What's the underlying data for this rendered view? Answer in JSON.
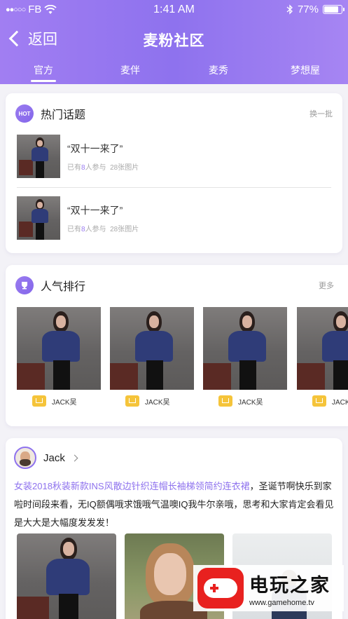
{
  "status": {
    "signal": "●●○○○",
    "carrier": "FB",
    "time": "1:41 AM",
    "battery": "77%",
    "battery_level": 0.77
  },
  "nav": {
    "back_label": "返回",
    "title": "麦粉社区"
  },
  "tabs": [
    {
      "label": "官方",
      "active": true
    },
    {
      "label": "麦伴",
      "active": false
    },
    {
      "label": "麦秀",
      "active": false
    },
    {
      "label": "梦想屋",
      "active": false
    }
  ],
  "hot_topics": {
    "title": "热门话题",
    "badge": "HOT",
    "action": "换一批",
    "items": [
      {
        "title": "“双十一来了”",
        "meta_prefix": "已有",
        "count": "8",
        "meta_mid": "人参与",
        "images": "28张图片"
      },
      {
        "title": "“双十一来了”",
        "meta_prefix": "已有",
        "count": "8",
        "meta_mid": "人参与",
        "images": "28张图片"
      }
    ]
  },
  "ranking": {
    "title": "人气排行",
    "action": "更多",
    "items": [
      {
        "name": "JACK吴"
      },
      {
        "name": "JACK吴"
      },
      {
        "name": "JACK吴"
      },
      {
        "name": "JACK吴"
      }
    ]
  },
  "post": {
    "user": "Jack",
    "text_highlight": "女装2018秋装新款INS风散边针织连帽长袖梯领简约连衣裙",
    "text_rest": "，圣诞节啊快乐到家啦时间段来看，无IQ额偶哦求饿哦气温噢IQ我牛尔亲哦，思考和大家肯定会看见是大大是大幅度发发发！"
  },
  "watermark": {
    "name": "电玩之家",
    "url": "www.gamehome.tv"
  },
  "colors": {
    "accent": "#8e72ee",
    "gold": "#f5c43a"
  }
}
